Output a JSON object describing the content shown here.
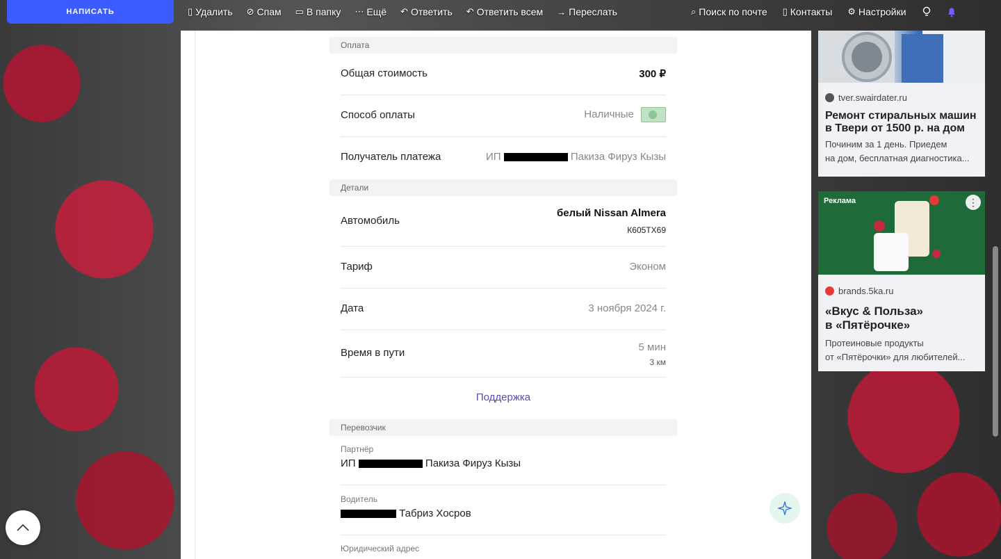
{
  "toolbar": {
    "compose_label": "НАПИСАТЬ",
    "actions": [
      {
        "icon": "trash-icon",
        "glyph": "▯",
        "label": "Удалить"
      },
      {
        "icon": "spam-icon",
        "glyph": "⊘",
        "label": "Спам"
      },
      {
        "icon": "folder-icon",
        "glyph": "▭",
        "label": "В папку"
      },
      {
        "icon": "more-icon",
        "glyph": "⋯",
        "label": "Ещё"
      },
      {
        "icon": "reply-icon",
        "glyph": "↶",
        "label": "Ответить"
      },
      {
        "icon": "reply-all-icon",
        "glyph": "↶",
        "label": "Ответить всем"
      },
      {
        "icon": "forward-icon",
        "glyph": "→",
        "label": "Переслать"
      }
    ],
    "right": [
      {
        "icon": "search-icon",
        "glyph": "⌕",
        "label": "Поиск по почте"
      },
      {
        "icon": "contacts-icon",
        "glyph": "▯",
        "label": "Контакты"
      },
      {
        "icon": "gear-icon",
        "glyph": "⚙",
        "label": "Настройки"
      }
    ]
  },
  "payment": {
    "section": "Оплата",
    "total_label": "Общая стоимость",
    "total_value": "300 ₽",
    "method_label": "Способ оплаты",
    "method_value": "Наличные",
    "recipient_label": "Получатель платежа",
    "recipient_prefix": "ИП",
    "recipient_name": "Пакиза Фируз Кызы"
  },
  "details": {
    "section": "Детали",
    "car_label": "Автомобиль",
    "car_value": "белый Nissan Almera",
    "car_plate": "К605ТХ69",
    "tariff_label": "Тариф",
    "tariff_value": "Эконом",
    "date_label": "Дата",
    "date_value": "3 ноября 2024 г.",
    "duration_label": "Время в пути",
    "duration_value": "5 мин",
    "distance_value": "3 км"
  },
  "support_link": "Поддержка",
  "carrier": {
    "section": "Перевозчик",
    "partner_label": "Партнёр",
    "partner_prefix": "ИП",
    "partner_name": "Пакиза Фируз Кызы",
    "driver_label": "Водитель",
    "driver_name": "Табриз Хосров",
    "address_label": "Юридический адрес"
  },
  "ads": [
    {
      "source": "tver.swairdater.ru",
      "title_line1": "Ремонт стиральных машин",
      "title_line2": "в Твери от 1500 р. на дом",
      "desc_line1": "Починим за 1 день. Приедем",
      "desc_line2": "на дом, бесплатная диагностика..."
    },
    {
      "badge": "Реклама",
      "source": "brands.5ka.ru",
      "title_line1": "«Вкус & Польза»",
      "title_line2": "в «Пятёрочке»",
      "desc_line1": "Протеиновые продукты",
      "desc_line2": "от «Пятёрочки» для любителей..."
    }
  ],
  "colors": {
    "compose": "#3d5cff",
    "support_link": "#5a4bb4",
    "section_bg": "#f3f3f3"
  }
}
